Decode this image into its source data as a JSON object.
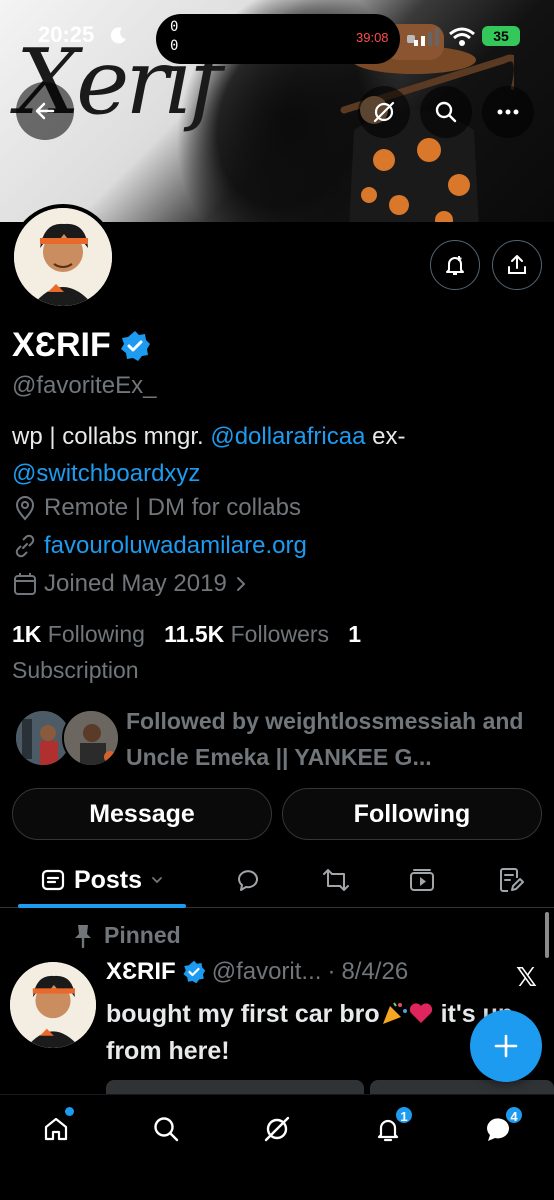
{
  "status_bar": {
    "time": "20:25",
    "island_line1": "0",
    "island_line2": "0",
    "timer": "39:08",
    "battery": "35"
  },
  "banner": {
    "logo_text": "Xerif"
  },
  "profile": {
    "display_name": "XƐRIF",
    "handle": "@favoriteEx_",
    "bio_prefix": "wp | collabs mngr. ",
    "bio_mention1": "@dollarafricaa",
    "bio_mid": " ex-",
    "bio_mention2": "@switchboardxyz",
    "location": "Remote | DM for collabs",
    "website": "favouroluwadamilare.org",
    "joined": "Joined May 2019"
  },
  "stats": {
    "following_count": "1K",
    "following_label": "Following",
    "followers_count": "11.5K",
    "followers_label": "Followers",
    "subscription_count": "1",
    "subscription_label": "Subscription"
  },
  "followed_by": "Followed by weightlossmessiah and Uncle Emeka || YANKEE G...",
  "actions": {
    "message": "Message",
    "following": "Following"
  },
  "tabs": {
    "posts": "Posts"
  },
  "pinned_post": {
    "pinned_label": "Pinned",
    "author": "XƐRIF",
    "handle_trunc": "@favorit...",
    "separator": "·",
    "date": "8/4/26",
    "text_part1": "bought my first car bro",
    "text_part2": " it's up from here!"
  },
  "nav": {
    "notifications_badge": "1",
    "messages_badge": "4"
  },
  "colors": {
    "accent": "#1d9bf0",
    "background": "#000000",
    "muted": "#71767b",
    "battery": "#34c759"
  }
}
